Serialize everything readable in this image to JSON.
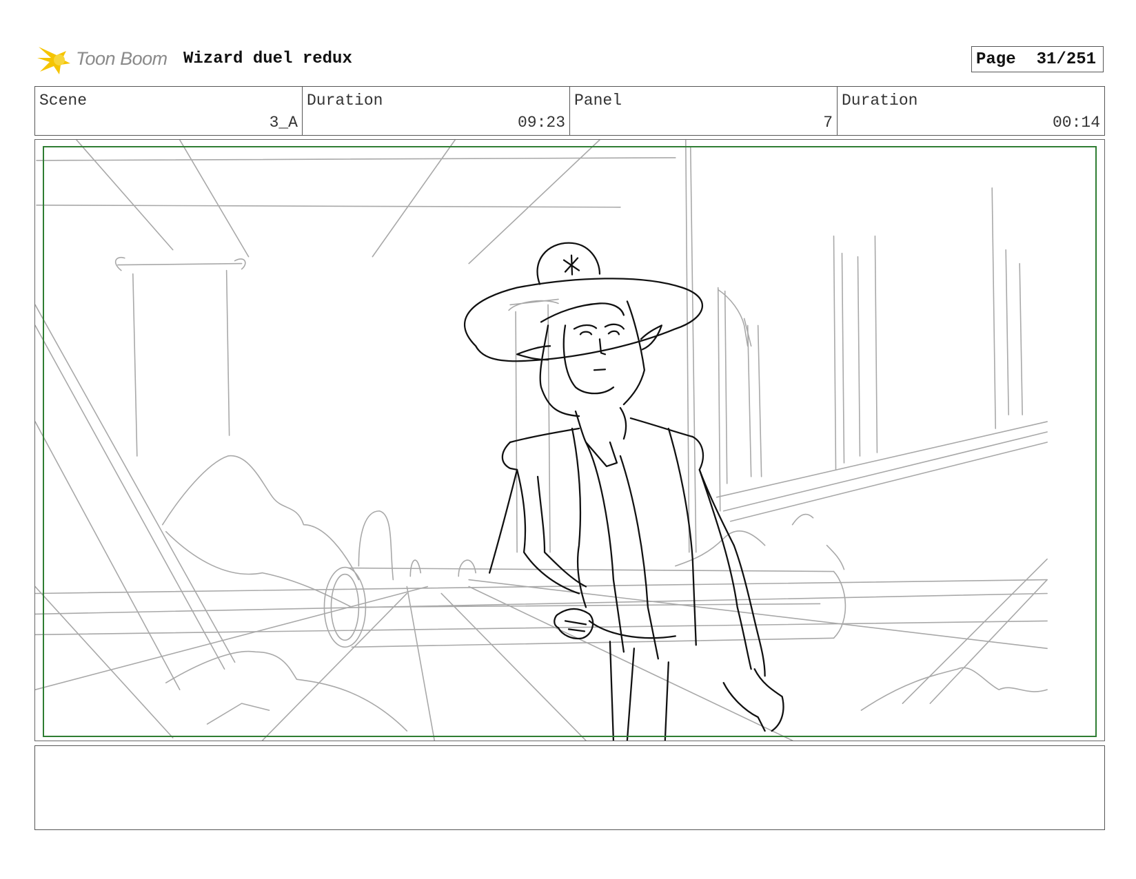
{
  "header": {
    "logo_text": "Toon Boom",
    "doc_title": "Wizard duel redux",
    "page_label": "Page",
    "page_value": "31/251"
  },
  "info": {
    "scene": {
      "label": "Scene",
      "value": "3_A"
    },
    "scene_duration": {
      "label": "Duration",
      "value": "09:23"
    },
    "panel": {
      "label": "Panel",
      "value": "7"
    },
    "panel_duration": {
      "label": "Duration",
      "value": "00:14"
    }
  },
  "notes": {
    "text": ""
  },
  "colors": {
    "safe_frame": "#2e7d32",
    "logo_yellow": "#f5c400",
    "sketch_background": "#9a9a9a",
    "sketch_character": "#111111"
  },
  "icons": {
    "logo": "toon-boom-burst-icon"
  }
}
